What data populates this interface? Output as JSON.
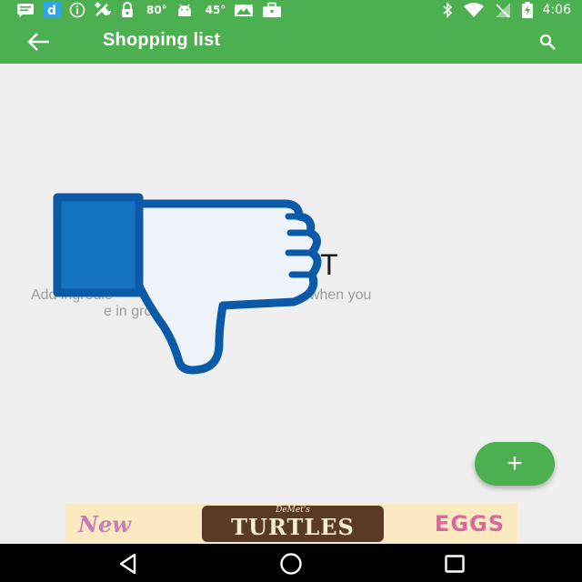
{
  "status_bar": {
    "temp_1": "80°",
    "temp_2": "45°",
    "time": "4:06",
    "icons": [
      "message-icon",
      "d-app-icon",
      "info-icon",
      "satellite-icon",
      "lock-icon",
      "android-icon",
      "photo-icon",
      "briefcase-icon",
      "bluetooth-icon",
      "wifi-icon",
      "signal-icon",
      "battery-charging-icon"
    ]
  },
  "app_bar": {
    "title": "Shopping list",
    "back_icon": "arrow-left-icon",
    "search_icon": "search-icon"
  },
  "empty_state": {
    "title": "G LIST",
    "description": "Add ingredie                       k and buy them when you\n                  e in grocery store."
  },
  "overlay": {
    "icon": "thumbs-down-icon",
    "colors": {
      "stroke": "#0a5aa8",
      "fill_light": "#eef3fa",
      "fill_cuff": "#1673c2"
    }
  },
  "fab": {
    "label": "+",
    "color": "#4caf50"
  },
  "ad": {
    "left_text": "New",
    "brand": "DeMet's",
    "product": "TURTLES",
    "right_text": "EGGS"
  },
  "nav_bar": {
    "icons": [
      "nav-back-icon",
      "nav-home-icon",
      "nav-recent-icon"
    ]
  },
  "colors": {
    "primary": "#4caf50",
    "background": "#efefef"
  }
}
